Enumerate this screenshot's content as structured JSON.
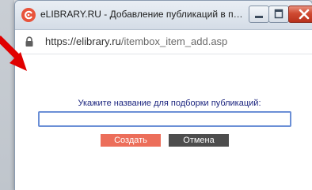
{
  "window": {
    "title": "eLIBRARY.RU - Добавление публикаций в пер...",
    "controls": {
      "minimize_icon": "minimize-icon",
      "maximize_icon": "maximize-icon",
      "close_icon": "close-icon"
    },
    "logo_icon": "elibrary-logo-icon"
  },
  "address_bar": {
    "scheme": "https://",
    "host": "elibrary.ru",
    "path": "/itembox_item_add.asp",
    "lock_icon": "lock-icon"
  },
  "dialog": {
    "prompt": "Укажите название для подборки публикаций:",
    "name_input": {
      "value": "",
      "placeholder": ""
    },
    "create_label": "Создать",
    "cancel_label": "Отмена"
  },
  "colors": {
    "create_button": "#ec6e5a",
    "cancel_button": "#4d4d4d",
    "prompt_text": "#1a237e",
    "input_border": "#6b8fd6",
    "close_button": "#cf4a32",
    "logo": "#e8533b",
    "annotation_arrow": "#e00000"
  },
  "annotation": {
    "arrow_icon": "red-arrow-icon"
  }
}
